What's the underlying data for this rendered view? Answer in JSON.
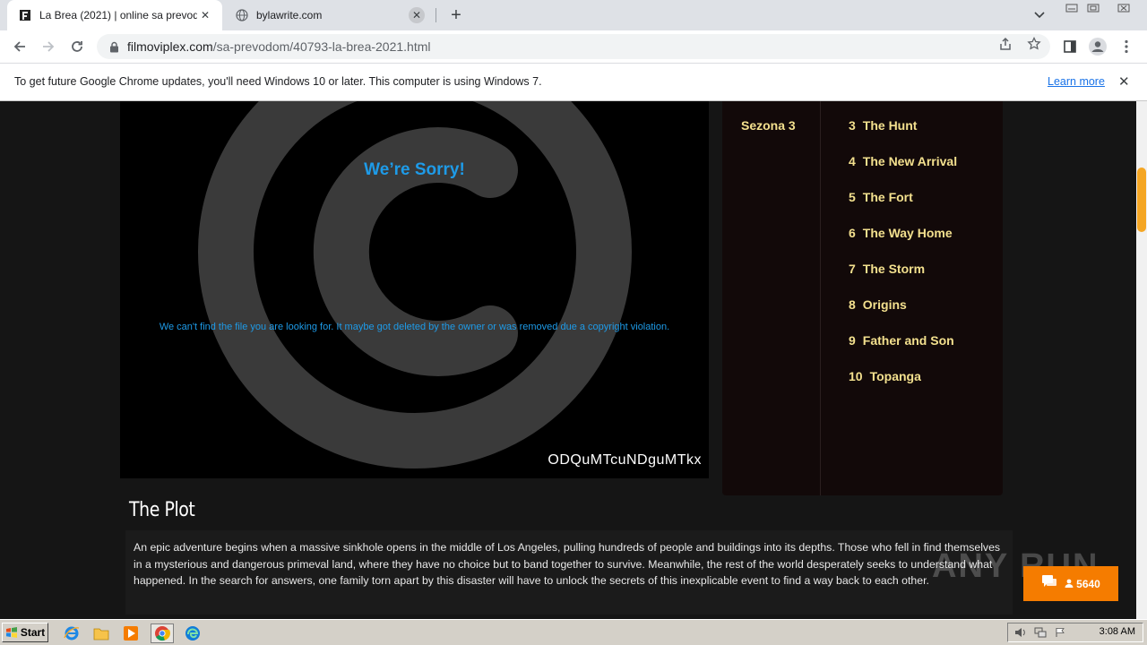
{
  "browser": {
    "tabs": [
      {
        "title": "La Brea (2021) | online sa prevodom",
        "active": true
      },
      {
        "title": "bylawrite.com",
        "active": false
      }
    ],
    "url_domain": "filmoviplex.com",
    "url_path": "/sa-prevodom/40793-la-brea-2021.html",
    "infobar_message": "To get future Google Chrome updates, you'll need Windows 10 or later. This computer is using Windows 7.",
    "infobar_link": "Learn more"
  },
  "player": {
    "heading": "We’re Sorry!",
    "message": "We can't find the file you are looking for. It maybe got deleted by the owner or was removed due a copyright violation.",
    "code": "ODQuMTcuNDguMTkx"
  },
  "episodes": {
    "season_label": "Sezona 3",
    "items": [
      {
        "num": "3",
        "title": "The Hunt"
      },
      {
        "num": "4",
        "title": "The New Arrival"
      },
      {
        "num": "5",
        "title": "The Fort"
      },
      {
        "num": "6",
        "title": "The Way Home"
      },
      {
        "num": "7",
        "title": "The Storm"
      },
      {
        "num": "8",
        "title": "Origins"
      },
      {
        "num": "9",
        "title": "Father and Son"
      },
      {
        "num": "10",
        "title": "Topanga"
      }
    ]
  },
  "plot": {
    "title": "The Plot",
    "text": "An epic adventure begins when a massive sinkhole opens in the middle of Los Angeles, pulling hundreds of people and buildings into its depths. Those who fell in find themselves in a mysterious and dangerous primeval land, where they have no choice but to band together to survive. Meanwhile, the rest of the world desperately seeks to understand what happened. In the search for answers, one family torn apart by this disaster will have to unlock the secrets of this inexplicable event to find a way back to each other."
  },
  "chat_widget": {
    "count": "5640"
  },
  "watermark": "ANY RUN",
  "taskbar": {
    "start_label": "Start",
    "clock": "3:08 AM"
  },
  "colors": {
    "accent_blue": "#1e9be8",
    "episode_gold": "#f3e08e",
    "chat_orange": "#f57c00",
    "scroll_thumb": "#f5a623"
  }
}
